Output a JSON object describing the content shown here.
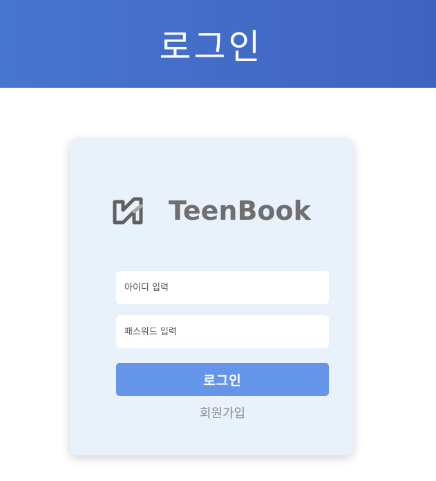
{
  "header": {
    "title": "로그인"
  },
  "card": {
    "logo_text": "TeenBook",
    "logo_icon": "teenbook-logo-icon",
    "id_field": {
      "placeholder": "아이디 입력",
      "value": ""
    },
    "password_field": {
      "placeholder": "패스워드 입력",
      "value": ""
    },
    "login_button_label": "로그인",
    "signup_link_label": "회원가입"
  },
  "colors": {
    "header_gradient_start": "#4776cf",
    "header_gradient_end": "#3f63c0",
    "card_background": "#e9f1fa",
    "button_background": "#6495e9",
    "logo_text": "#6f6f6f"
  }
}
